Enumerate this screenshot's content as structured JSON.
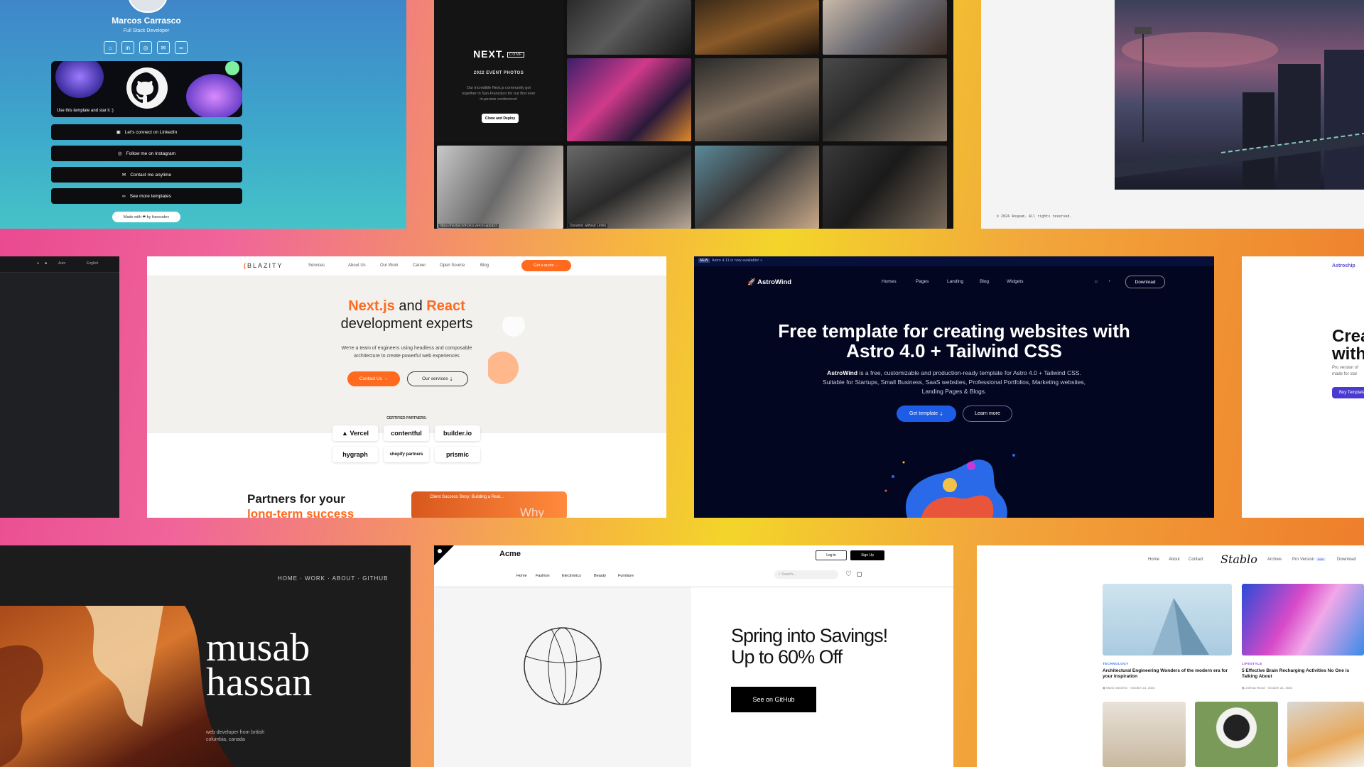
{
  "linktree": {
    "name": "Marcos Carrasco",
    "role": "Full Stack Developer",
    "banner_text": "Use this template and star it :)",
    "links": [
      "Let's connect on LinkedIn",
      "Follow me on Instagram",
      "Contact me anytime",
      "See more templates"
    ],
    "made_with": "Made with ❤ by francodev"
  },
  "event": {
    "logo": "NEXT.",
    "logo_badge": "CONF",
    "title": "2022 EVENT PHOTOS",
    "description": "Our incredible Next.js community got together in San Francisco for our first ever in-person conference!",
    "button": "Clone and Deploy",
    "url": "https://nextjsconf-pics.vercel.app/p/3",
    "caption": "Dynamic without Limits"
  },
  "photoblog": {
    "copyright": "© 2024 Anupam. All rights reserved."
  },
  "darkdocs": {
    "menu": [
      "Auto",
      "English"
    ]
  },
  "blazity": {
    "brand": "BLAZITY",
    "nav": [
      "Services",
      "About Us",
      "Our Work",
      "Career",
      "Open Source",
      "Blog"
    ],
    "quote_button": "Get a quote",
    "headline_a": "Next.js",
    "headline_and": " and ",
    "headline_b": "React",
    "headline_rest": "development experts",
    "subtitle_1": "We're a team of engineers using headless and composable",
    "subtitle_2": "architecture to create powerful web experiences",
    "contact_button": "Contact Us",
    "services_button": "Our services",
    "certified": "CERTIFIED PARTNERS:",
    "partners": [
      "Vercel",
      "contentful",
      "builder.io",
      "hygraph",
      "shopify partners",
      "prismic"
    ],
    "section_a": "Partners for your",
    "section_b": "long-term success",
    "video_title": "Client Success Story: Building a Real...",
    "video_word": "Why"
  },
  "astrowind": {
    "announce_badge": "NEW",
    "announce": "Astro 4.11 is now available! »",
    "brand": "AstroWind",
    "nav": [
      "Homes",
      "Pages",
      "Landing",
      "Blog",
      "Widgets"
    ],
    "download": "Download",
    "headline_1": "Free template for creating websites with",
    "headline_2": "Astro 4.0 + Tailwind CSS",
    "subtitle_brand": "AstroWind",
    "subtitle": " is a free, customizable and production-ready template for Astro 4.0 + Tailwind CSS. Suitable for Startups, Small Business, SaaS websites, Professional Portfolios, Marketing websites, Landing Pages & Blogs.",
    "get_template": "Get template",
    "learn_more": "Learn more"
  },
  "astroship": {
    "brand": "Astroship",
    "headline_1": "Crea",
    "headline_2": "with",
    "text_1": "Pro version of",
    "text_2": "made for star",
    "button": "Buy Template"
  },
  "portfolio": {
    "nav": "HOME · WORK · ABOUT · GITHUB",
    "name_1": "musab",
    "name_2": "hassan",
    "tagline": "web developer from british columbia, canada"
  },
  "acme": {
    "brand": "Acme",
    "login": "Log in",
    "signup": "Sign Up",
    "nav": [
      "Home",
      "Fashion",
      "Electronics",
      "Beauty",
      "Furniture"
    ],
    "search_placeholder": "Search...",
    "headline_1": "Spring into Savings!",
    "headline_2": "Up to 60% Off",
    "cta": "See on GitHub"
  },
  "stablo": {
    "nav_left": [
      "Home",
      "About",
      "Contact"
    ],
    "logo": "Stablo",
    "nav_right": [
      "Archive",
      "Pro Version",
      "Download"
    ],
    "pro_badge": "new",
    "posts": [
      {
        "category": "TECHNOLOGY",
        "title": "Architectural Engineering Wonders of the modern era for your Inspiration",
        "author": "Mario Sanchez",
        "date": "October 21, 2022"
      },
      {
        "category": "LIFESTYLE",
        "title": "5 Effective Brain Recharging Activities No One is Talking About",
        "author": "Joshua Wood",
        "date": "October 21, 2022"
      }
    ]
  }
}
